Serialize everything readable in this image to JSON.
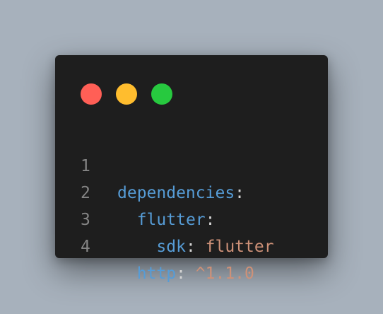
{
  "window_controls": {
    "close_color": "#ff5f56",
    "minimize_color": "#ffbd2e",
    "maximize_color": "#27c93f"
  },
  "colors": {
    "key": "#569cd6",
    "value": "#ce9178",
    "line_number": "#858585",
    "background": "#1e1e1e"
  },
  "code": {
    "lines": [
      {
        "number": "1",
        "indent": "",
        "key": "dependencies",
        "sep": ":",
        "value": ""
      },
      {
        "number": "2",
        "indent": "  ",
        "key": "flutter",
        "sep": ":",
        "value": ""
      },
      {
        "number": "3",
        "indent": "    ",
        "key": "sdk",
        "sep": ": ",
        "value": "flutter"
      },
      {
        "number": "4",
        "indent": "  ",
        "key": "http",
        "sep": ": ",
        "value": "^1.1.0"
      }
    ]
  }
}
